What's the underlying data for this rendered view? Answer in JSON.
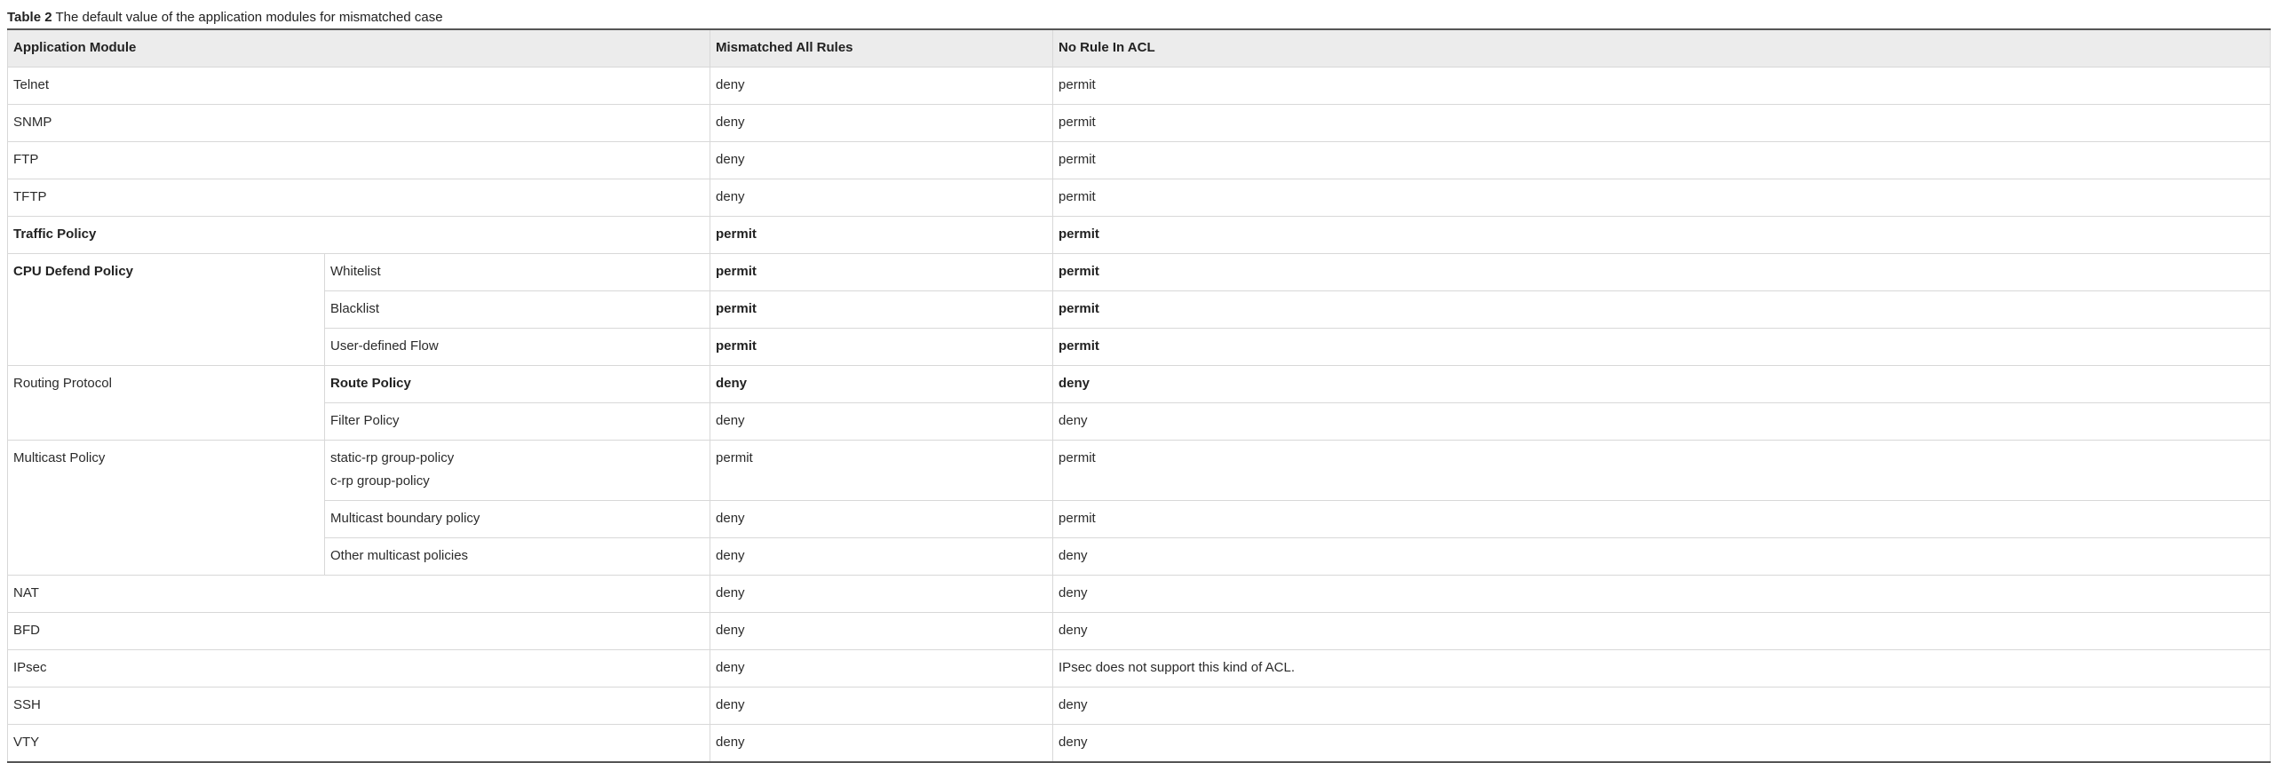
{
  "caption": {
    "label": "Table 2",
    "text": "The default value of the application modules for mismatched case"
  },
  "headers": {
    "module": "Application Module",
    "mismatched": "Mismatched All Rules",
    "no_rule": "No Rule In ACL"
  },
  "rows": {
    "telnet": {
      "module": "Telnet",
      "mismatched": "deny",
      "no_rule": "permit"
    },
    "snmp": {
      "module": "SNMP",
      "mismatched": "deny",
      "no_rule": "permit"
    },
    "ftp": {
      "module": "FTP",
      "mismatched": "deny",
      "no_rule": "permit"
    },
    "tftp": {
      "module": "TFTP",
      "mismatched": "deny",
      "no_rule": "permit"
    },
    "traffic_policy": {
      "module": "Traffic Policy",
      "mismatched": "permit",
      "no_rule": "permit"
    },
    "cpu_defend": {
      "module": "CPU Defend Policy",
      "whitelist": {
        "sub": "Whitelist",
        "mismatched": "permit",
        "no_rule": "permit"
      },
      "blacklist": {
        "sub": "Blacklist",
        "mismatched": "permit",
        "no_rule": "permit"
      },
      "user_flow": {
        "sub": "User-defined Flow",
        "mismatched": "permit",
        "no_rule": "permit"
      }
    },
    "routing": {
      "module": "Routing Protocol",
      "route_policy": {
        "sub": "Route Policy",
        "mismatched": "deny",
        "no_rule": "deny"
      },
      "filter_policy": {
        "sub": "Filter Policy",
        "mismatched": "deny",
        "no_rule": "deny"
      }
    },
    "multicast": {
      "module": "Multicast Policy",
      "group_policy": {
        "sub_line1": "static-rp group-policy",
        "sub_line2": "c-rp group-policy",
        "mismatched": "permit",
        "no_rule": "permit"
      },
      "boundary": {
        "sub": "Multicast boundary policy",
        "mismatched": "deny",
        "no_rule": "permit"
      },
      "other": {
        "sub": "Other multicast policies",
        "mismatched": "deny",
        "no_rule": "deny"
      }
    },
    "nat": {
      "module": "NAT",
      "mismatched": "deny",
      "no_rule": "deny"
    },
    "bfd": {
      "module": "BFD",
      "mismatched": "deny",
      "no_rule": "deny"
    },
    "ipsec": {
      "module": "IPsec",
      "mismatched": "deny",
      "no_rule": "IPsec does not support this kind of ACL."
    },
    "ssh": {
      "module": "SSH",
      "mismatched": "deny",
      "no_rule": "deny"
    },
    "vty": {
      "module": "VTY",
      "mismatched": "deny",
      "no_rule": "deny"
    }
  }
}
